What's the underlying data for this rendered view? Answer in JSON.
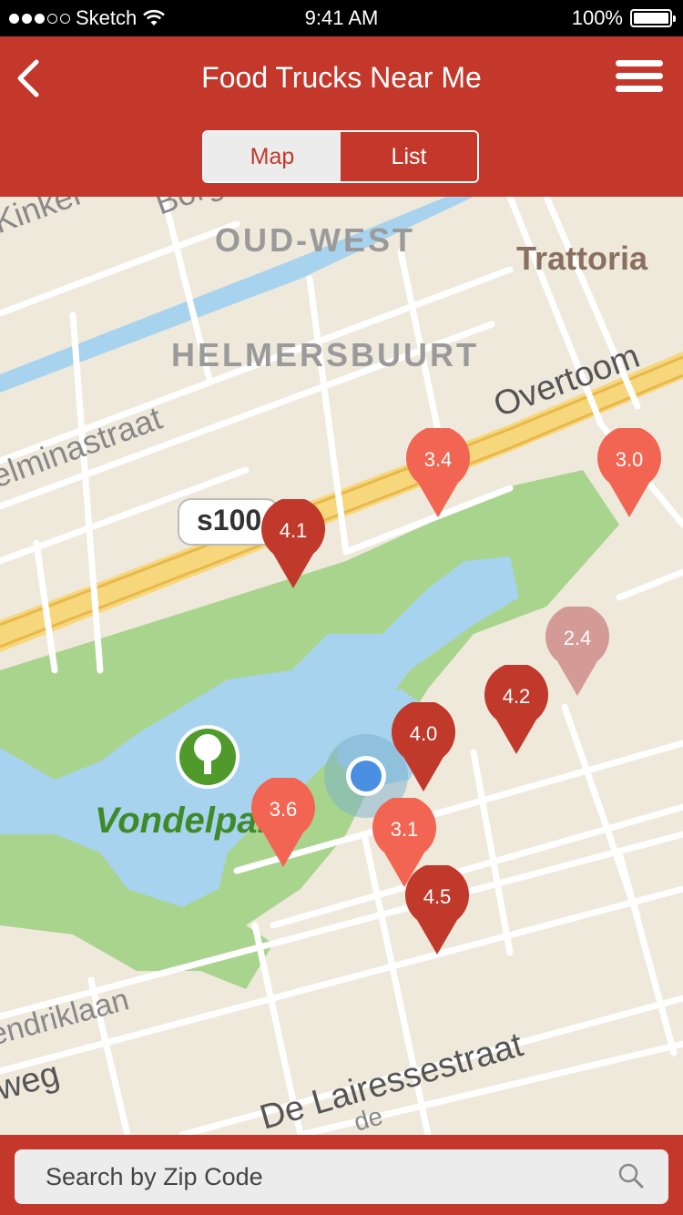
{
  "status_bar": {
    "carrier": "Sketch",
    "time": "9:41 AM",
    "battery": "100%",
    "signal_bars": 3,
    "signal_total": 5
  },
  "nav": {
    "title": "Food Trucks Near Me",
    "back_icon": "chevron-left-icon",
    "menu_icon": "hamburger-menu-icon"
  },
  "segment": {
    "options": [
      "Map",
      "List"
    ],
    "selected": "Map"
  },
  "map": {
    "labels": {
      "oud_west": "OUD-WEST",
      "trattoria": "Trattoria",
      "helmersbuurt": "HELMERSBUURT",
      "overtoom": "Overtoom",
      "helminastraat": "elminastraat",
      "kinker": "Kinker",
      "borg": "Borg",
      "s100": "s100",
      "vondelpark": "Vondelpark",
      "hendriklaan": "endriklaan",
      "weg": "weg",
      "de_lairessestraat": "De Lairessestraat",
      "de": "de"
    },
    "pins": [
      {
        "rating": "3.4",
        "color": "#f26553"
      },
      {
        "rating": "3.0",
        "color": "#f26553"
      },
      {
        "rating": "4.1",
        "color": "#c0392b"
      },
      {
        "rating": "2.4",
        "color": "#d49a95"
      },
      {
        "rating": "4.2",
        "color": "#c0392b"
      },
      {
        "rating": "4.0",
        "color": "#c0392b"
      },
      {
        "rating": "3.6",
        "color": "#f26553"
      },
      {
        "rating": "3.1",
        "color": "#f26553"
      },
      {
        "rating": "4.5",
        "color": "#c0392b"
      }
    ]
  },
  "search": {
    "placeholder": "Search by Zip Code",
    "icon": "search-icon"
  },
  "colors": {
    "brand": "#c4372b",
    "park": "#a9d48d",
    "water": "#a7d3ee",
    "land": "#efe9dc",
    "road": "#ffffff",
    "highway": "#f7d77c"
  }
}
